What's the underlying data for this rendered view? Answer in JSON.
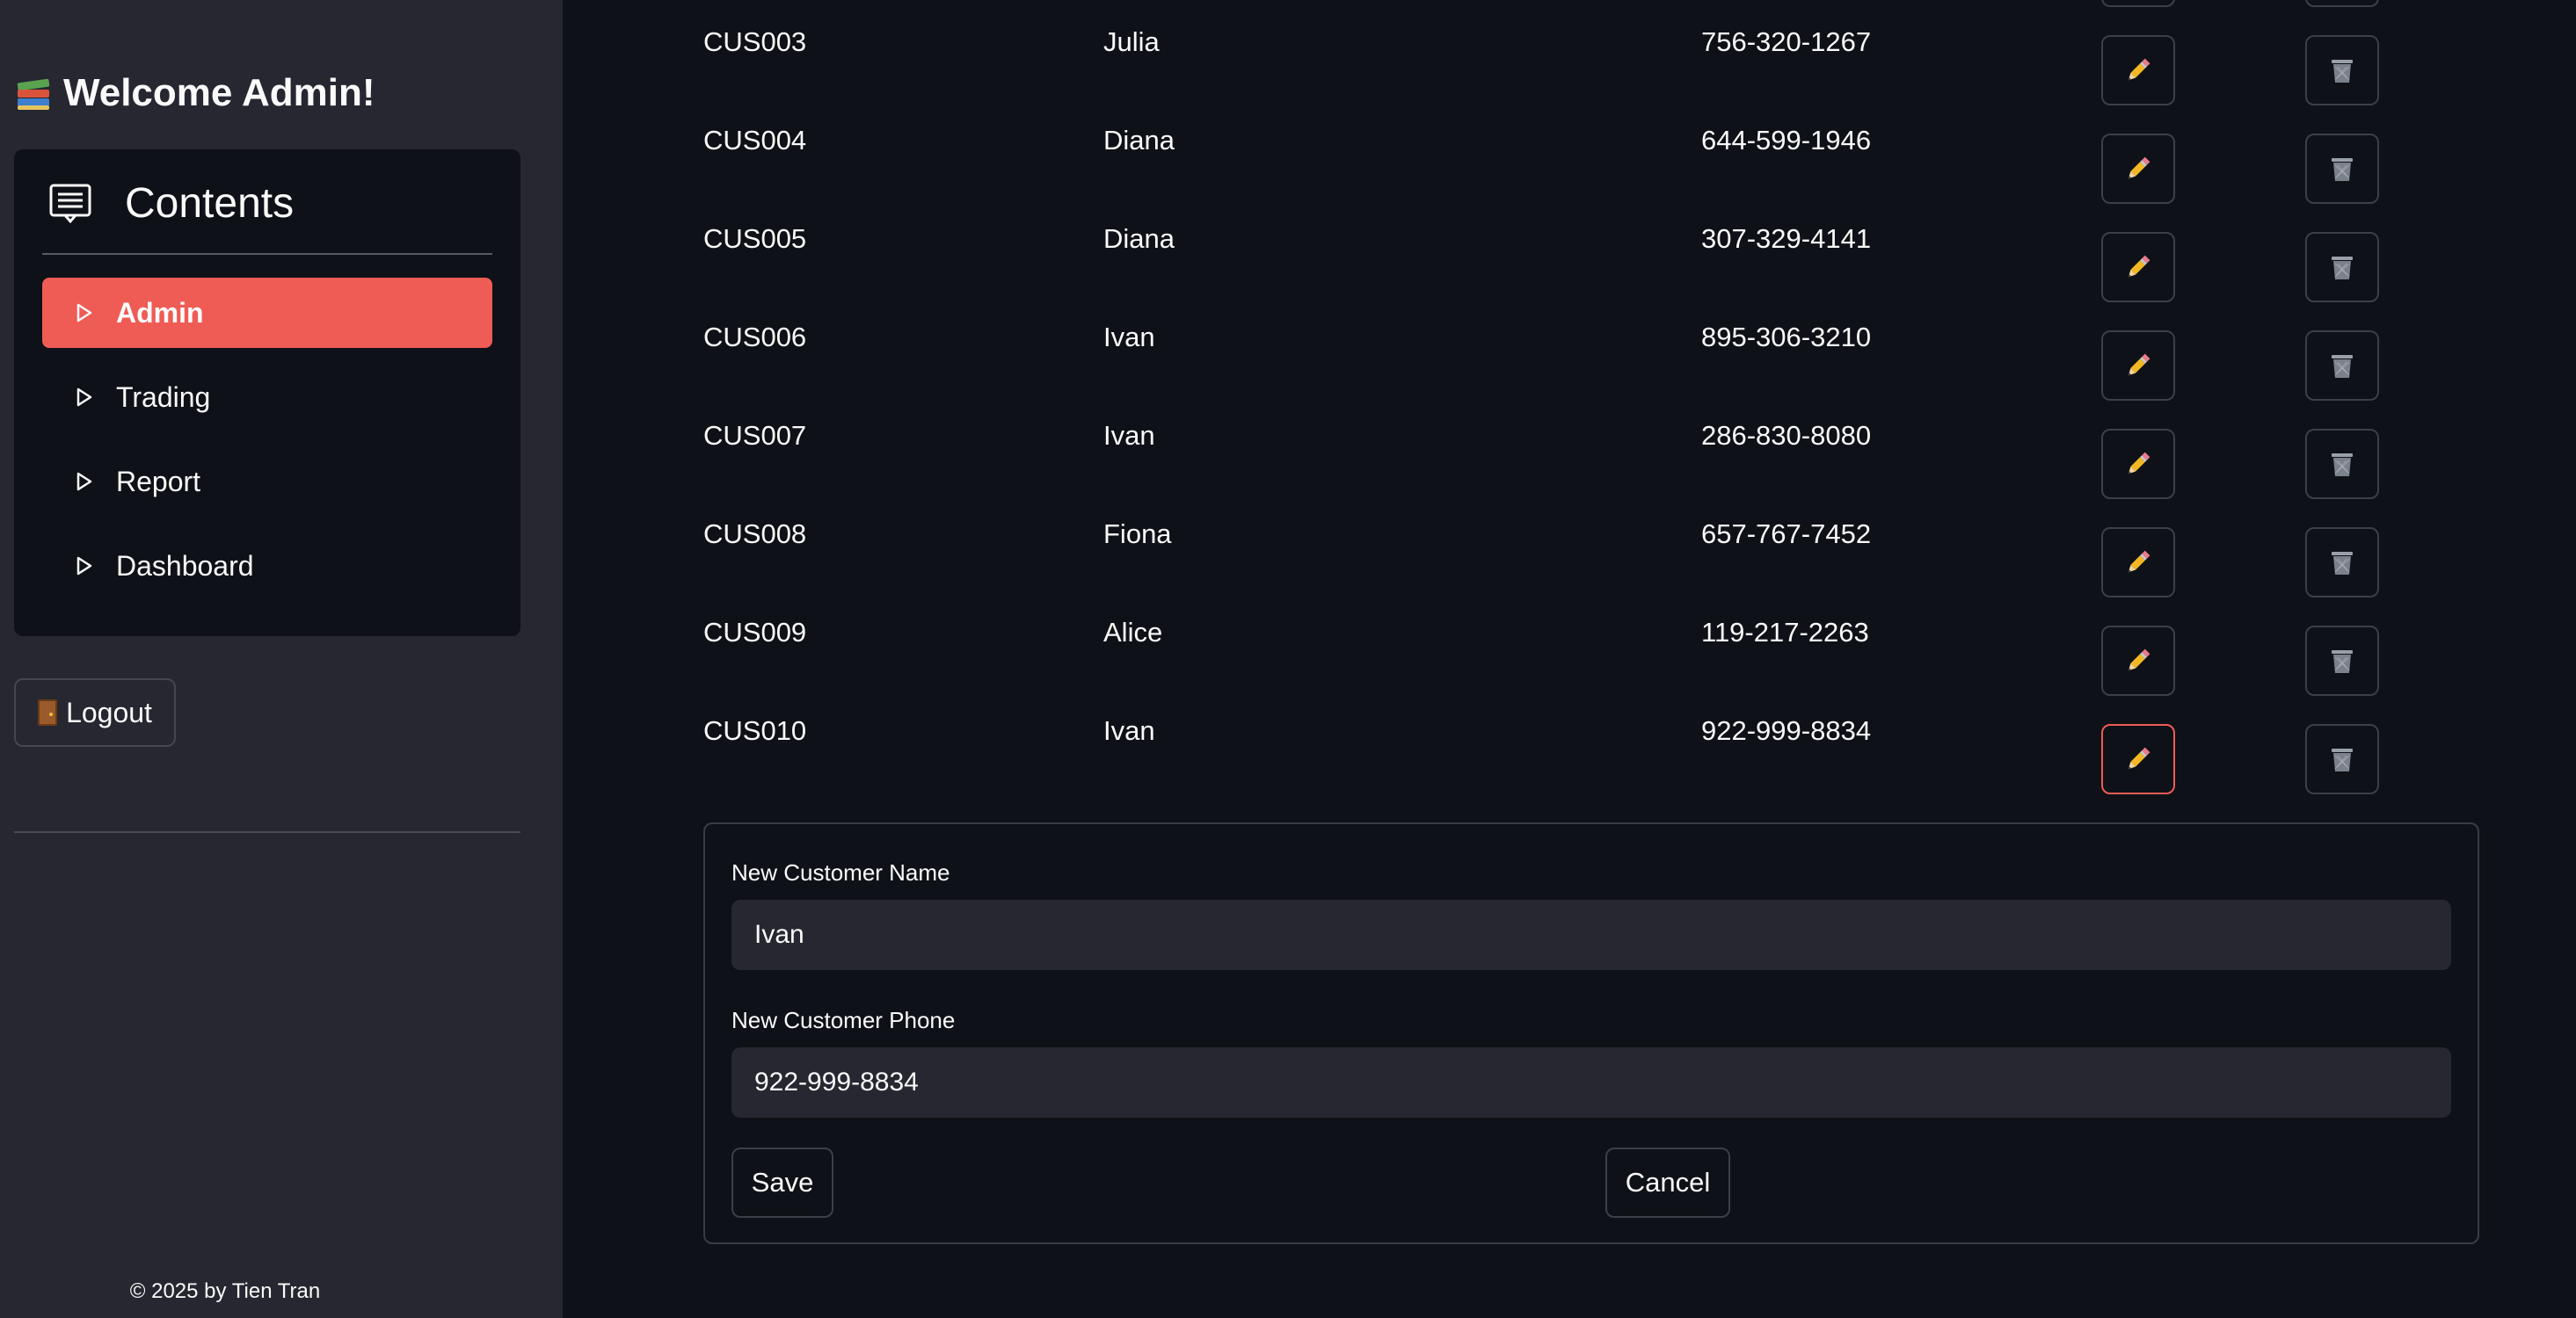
{
  "sidebar": {
    "welcome_text": "Welcome Admin!",
    "menu_title": "Contents",
    "items": [
      {
        "label": "Admin",
        "active": true
      },
      {
        "label": "Trading",
        "active": false
      },
      {
        "label": "Report",
        "active": false
      },
      {
        "label": "Dashboard",
        "active": false
      }
    ],
    "logout_label": "Logout",
    "copyright": "© 2025 by Tien Tran"
  },
  "customers": [
    {
      "id": "CUS003",
      "name": "Julia",
      "phone": "756-320-1267"
    },
    {
      "id": "CUS004",
      "name": "Diana",
      "phone": "644-599-1946"
    },
    {
      "id": "CUS005",
      "name": "Diana",
      "phone": "307-329-4141"
    },
    {
      "id": "CUS006",
      "name": "Ivan",
      "phone": "895-306-3210"
    },
    {
      "id": "CUS007",
      "name": "Ivan",
      "phone": "286-830-8080"
    },
    {
      "id": "CUS008",
      "name": "Fiona",
      "phone": "657-767-7452"
    },
    {
      "id": "CUS009",
      "name": "Alice",
      "phone": "119-217-2263"
    },
    {
      "id": "CUS010",
      "name": "Ivan",
      "phone": "922-999-8834"
    }
  ],
  "edit_form": {
    "name_label": "New Customer Name",
    "name_value": "Ivan",
    "phone_label": "New Customer Phone",
    "phone_value": "922-999-8834",
    "save_label": "Save",
    "cancel_label": "Cancel"
  },
  "colors": {
    "accent": "#ee5c55",
    "background": "#0e1117",
    "sidebar": "#262730"
  },
  "icons": {
    "edit": "pencil-icon",
    "delete": "trash-icon",
    "menu": "message-lines-icon",
    "welcome": "books-icon",
    "logout": "door-icon",
    "menu_item": "triangle-right-icon"
  }
}
